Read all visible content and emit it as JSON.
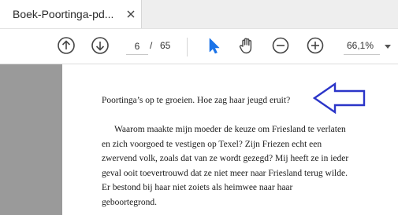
{
  "tab": {
    "title": "Boek-Poortinga-pd..."
  },
  "toolbar": {
    "current_page": "6",
    "page_separator": "/",
    "total_pages": "65",
    "zoom": "66,1%",
    "icons": {
      "prev": "arrow-up-circle-icon",
      "next": "arrow-down-circle-icon",
      "select": "cursor-arrow-icon",
      "hand": "hand-tool-icon",
      "zoom_out": "minus-circle-icon",
      "zoom_in": "plus-circle-icon"
    },
    "accent_color": "#1a73e8"
  },
  "document": {
    "heading": "Poortinga’s op te groeien.  Hoe zag haar jeugd eruit?",
    "paragraph_lines": [
      "Waarom maakte mijn moeder de keuze om Friesland te verlaten",
      "en zich voorgoed te vestigen op Texel? Zijn Friezen echt een",
      "zwervend volk, zoals dat van ze wordt gezegd? Mij heeft ze in ieder",
      "geval ooit toevertrouwd dat ze niet meer naar Friesland terug wilde.",
      "Er bestond bij haar niet zoiets als heimwee naar haar",
      "geboortegrond."
    ],
    "annotation_arrow_color": "#2b35c8"
  }
}
